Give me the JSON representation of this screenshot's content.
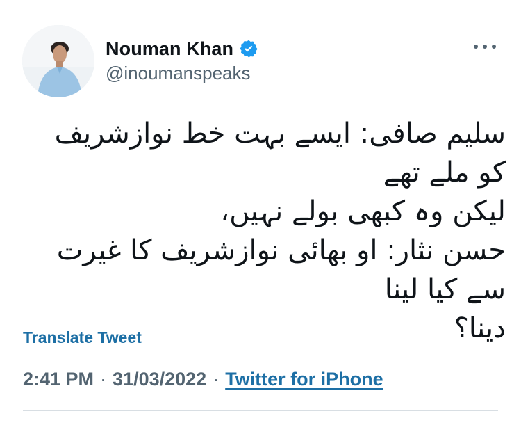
{
  "author": {
    "display_name": "Nouman Khan",
    "handle": "@inoumanspeaks",
    "verified_icon": "verified-badge-icon",
    "avatar_icon": "profile-photo"
  },
  "menu": {
    "more_icon": "more-options-icon"
  },
  "tweet": {
    "lines": [
      "سلیم صافی: ایسے بہت خط نوازشریف کو ملے تھے",
      "لیکن وہ کبھی بولے نہیں،",
      "حسن نثار: او بھائی نوازشریف کا غیرت سے کیا لینا",
      "دینا؟"
    ]
  },
  "actions": {
    "translate_label": "Translate Tweet"
  },
  "meta": {
    "time": "2:41 PM",
    "separator": "·",
    "date": "31/03/2022",
    "source": "Twitter for iPhone"
  },
  "colors": {
    "link": "#1d6fa5",
    "muted": "#536471",
    "text": "#0f1419",
    "verified": "#1d9bf0"
  }
}
